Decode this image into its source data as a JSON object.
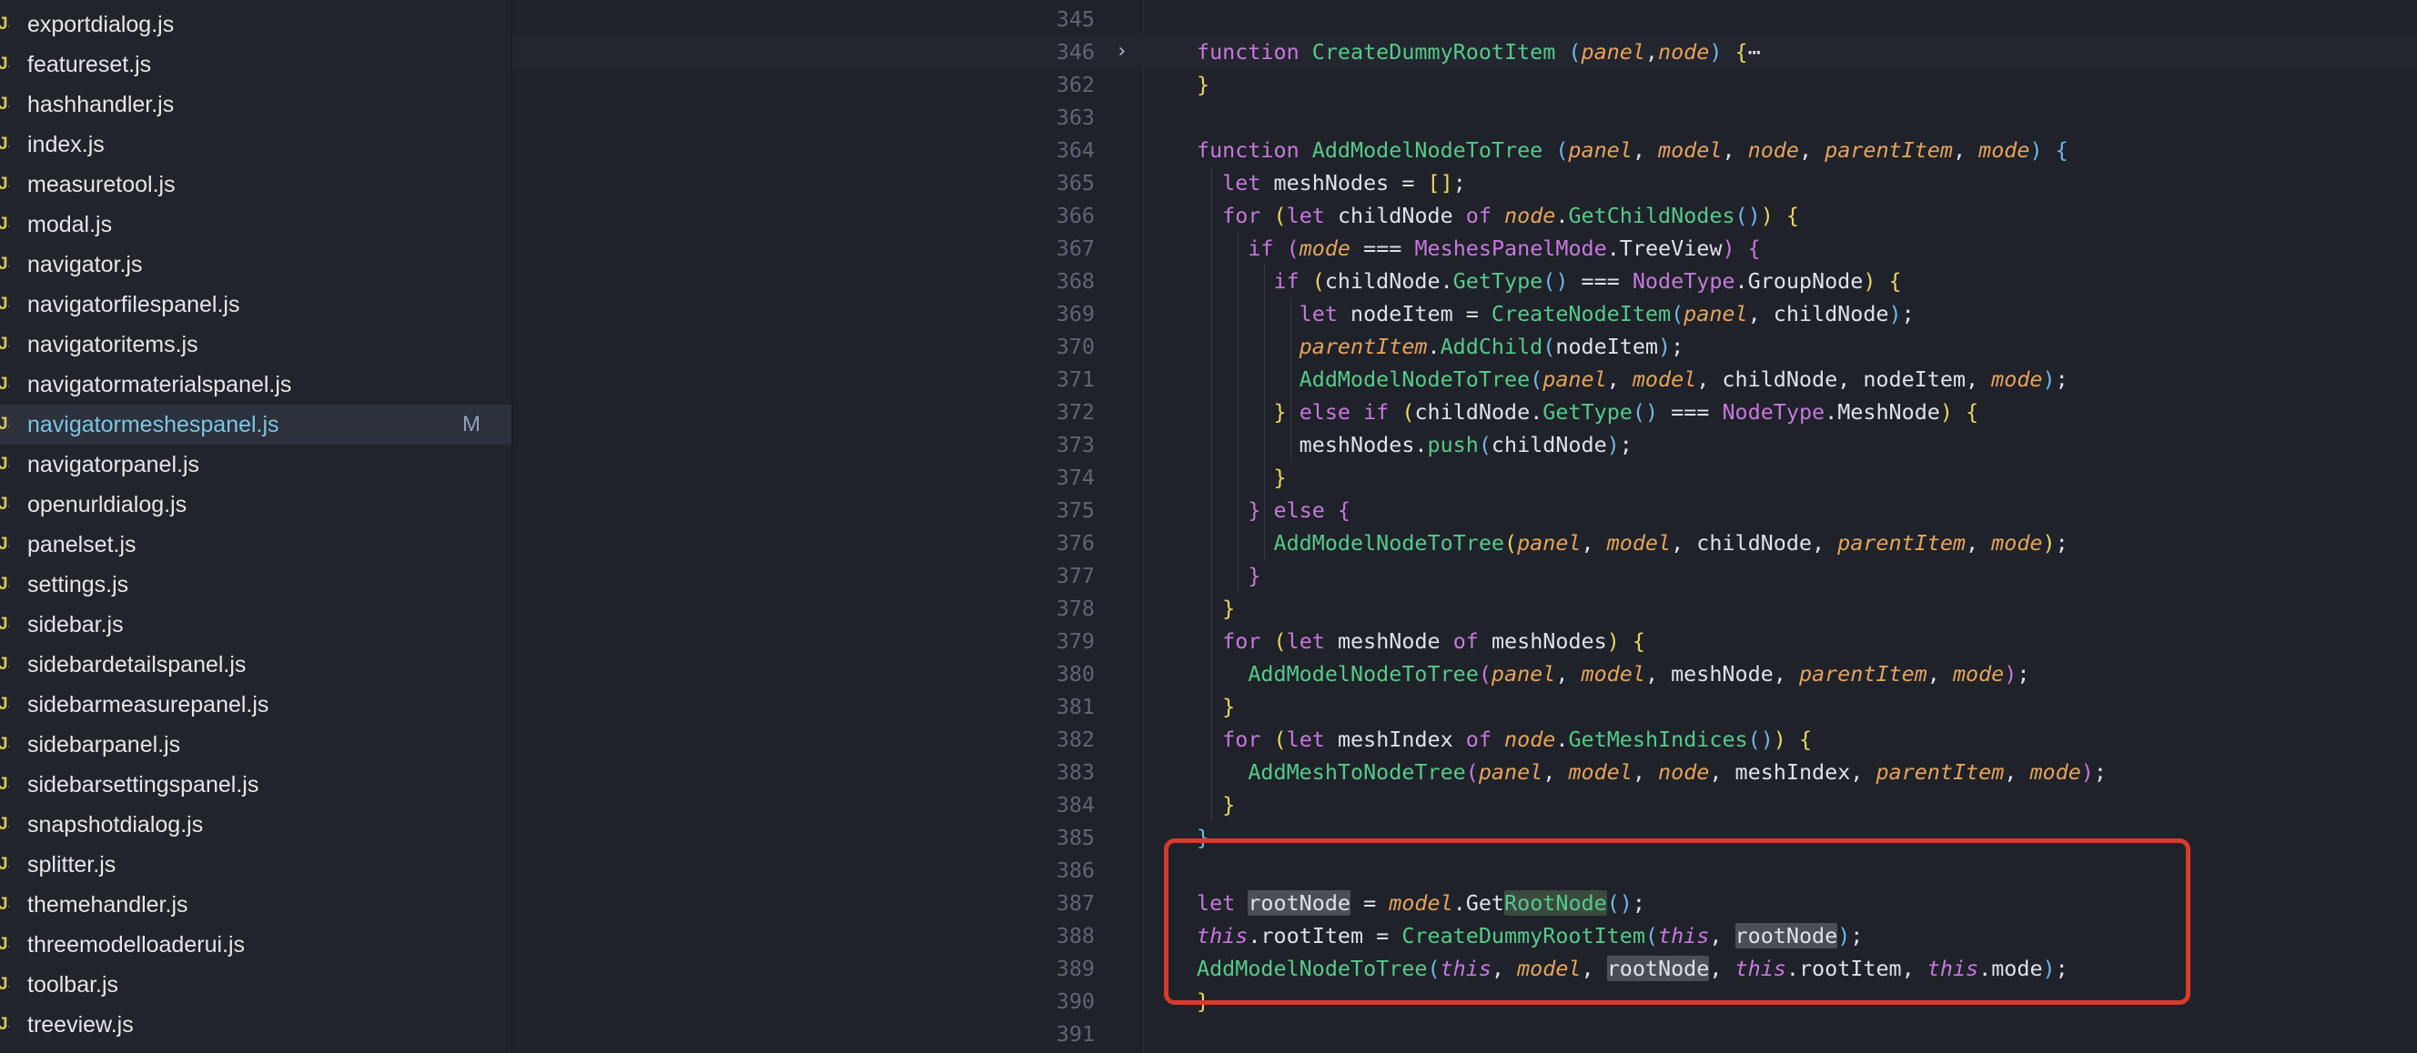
{
  "sidebar": {
    "files": [
      {
        "icon": "JS",
        "name": "exportdialog.js"
      },
      {
        "icon": "JS",
        "name": "featureset.js"
      },
      {
        "icon": "JS",
        "name": "hashhandler.js"
      },
      {
        "icon": "JS",
        "name": "index.js"
      },
      {
        "icon": "JS",
        "name": "measuretool.js"
      },
      {
        "icon": "JS",
        "name": "modal.js"
      },
      {
        "icon": "JS",
        "name": "navigator.js"
      },
      {
        "icon": "JS",
        "name": "navigatorfilespanel.js"
      },
      {
        "icon": "JS",
        "name": "navigatoritems.js"
      },
      {
        "icon": "JS",
        "name": "navigatormaterialspanel.js"
      },
      {
        "icon": "JS",
        "name": "navigatormeshespanel.js",
        "status": "M"
      },
      {
        "icon": "JS",
        "name": "navigatorpanel.js"
      },
      {
        "icon": "JS",
        "name": "openurldialog.js"
      },
      {
        "icon": "JS",
        "name": "panelset.js"
      },
      {
        "icon": "JS",
        "name": "settings.js"
      },
      {
        "icon": "JS",
        "name": "sidebar.js"
      },
      {
        "icon": "JS",
        "name": "sidebardetailspanel.js"
      },
      {
        "icon": "JS",
        "name": "sidebarmeasurepanel.js"
      },
      {
        "icon": "JS",
        "name": "sidebarpanel.js"
      },
      {
        "icon": "JS",
        "name": "sidebarsettingspanel.js"
      },
      {
        "icon": "JS",
        "name": "snapshotdialog.js"
      },
      {
        "icon": "JS",
        "name": "splitter.js"
      },
      {
        "icon": "JS",
        "name": "themehandler.js"
      },
      {
        "icon": "JS",
        "name": "threemodelloaderui.js"
      },
      {
        "icon": "JS",
        "name": "toolbar.js"
      },
      {
        "icon": "JS",
        "name": "treeview.js"
      }
    ]
  },
  "editor": {
    "lines": [
      {
        "n": "345",
        "tokens": []
      },
      {
        "n": "346",
        "fold": "›",
        "tokens": [
          [
            "k",
            "function "
          ],
          [
            "fn",
            "CreateDummyRootItem "
          ],
          [
            "pb",
            "("
          ],
          [
            "p",
            "panel"
          ],
          [
            "",
            ","
          ],
          [
            "p",
            "node"
          ],
          [
            "pb",
            ")"
          ],
          [
            "",
            " "
          ],
          [
            "pl",
            "{"
          ],
          [
            "",
            "⋯"
          ]
        ]
      },
      {
        "n": "362",
        "tokens": [
          [
            "pl",
            "}"
          ]
        ]
      },
      {
        "n": "363",
        "tokens": []
      },
      {
        "n": "364",
        "tokens": [
          [
            "k",
            "function "
          ],
          [
            "fn",
            "AddModelNodeToTree "
          ],
          [
            "pb",
            "("
          ],
          [
            "p",
            "panel"
          ],
          [
            "",
            ", "
          ],
          [
            "p",
            "model"
          ],
          [
            "",
            ", "
          ],
          [
            "p",
            "node"
          ],
          [
            "",
            ", "
          ],
          [
            "p",
            "parentItem"
          ],
          [
            "",
            ", "
          ],
          [
            "p",
            "mode"
          ],
          [
            "pb",
            ")"
          ],
          [
            "",
            " "
          ],
          [
            "pb",
            "{"
          ]
        ]
      },
      {
        "n": "365",
        "tokens": [
          [
            "",
            "  "
          ],
          [
            "k",
            "let "
          ],
          [
            "",
            "meshNodes = "
          ],
          [
            "pl",
            "[]"
          ],
          [
            "",
            ";"
          ]
        ]
      },
      {
        "n": "366",
        "tokens": [
          [
            "",
            "  "
          ],
          [
            "k",
            "for "
          ],
          [
            "pl",
            "("
          ],
          [
            "k",
            "let "
          ],
          [
            "",
            "childNode "
          ],
          [
            "k",
            "of "
          ],
          [
            "p",
            "node"
          ],
          [
            "",
            "."
          ],
          [
            "fn",
            "GetChildNodes"
          ],
          [
            "pb",
            "()"
          ],
          [
            "pl",
            ")"
          ],
          [
            "",
            " "
          ],
          [
            "pl",
            "{"
          ]
        ]
      },
      {
        "n": "367",
        "tokens": [
          [
            "",
            "    "
          ],
          [
            "k",
            "if "
          ],
          [
            "pu",
            "("
          ],
          [
            "p",
            "mode"
          ],
          [
            "",
            " === "
          ],
          [
            "cls",
            "MeshesPanelMode"
          ],
          [
            "",
            ".TreeView"
          ],
          [
            "pu",
            ")"
          ],
          [
            "",
            " "
          ],
          [
            "pu",
            "{"
          ]
        ]
      },
      {
        "n": "368",
        "tokens": [
          [
            "",
            "      "
          ],
          [
            "k",
            "if "
          ],
          [
            "pl",
            "("
          ],
          [
            "",
            "childNode."
          ],
          [
            "fn",
            "GetType"
          ],
          [
            "pb",
            "()"
          ],
          [
            "",
            " === "
          ],
          [
            "cls",
            "NodeType"
          ],
          [
            "",
            ".GroupNode"
          ],
          [
            "pl",
            ")"
          ],
          [
            "",
            " "
          ],
          [
            "pl",
            "{"
          ]
        ]
      },
      {
        "n": "369",
        "tokens": [
          [
            "",
            "        "
          ],
          [
            "k",
            "let "
          ],
          [
            "",
            "nodeItem = "
          ],
          [
            "fn",
            "CreateNodeItem"
          ],
          [
            "pb",
            "("
          ],
          [
            "p",
            "panel"
          ],
          [
            "",
            ", childNode"
          ],
          [
            "pb",
            ")"
          ],
          [
            "",
            ";"
          ]
        ]
      },
      {
        "n": "370",
        "tokens": [
          [
            "",
            "        "
          ],
          [
            "p",
            "parentItem"
          ],
          [
            "",
            "."
          ],
          [
            "fn",
            "AddChild"
          ],
          [
            "pb",
            "("
          ],
          [
            "",
            "nodeItem"
          ],
          [
            "pb",
            ")"
          ],
          [
            "",
            ";"
          ]
        ]
      },
      {
        "n": "371",
        "tokens": [
          [
            "",
            "        "
          ],
          [
            "fn",
            "AddModelNodeToTree"
          ],
          [
            "pb",
            "("
          ],
          [
            "p",
            "panel"
          ],
          [
            "",
            ", "
          ],
          [
            "p",
            "model"
          ],
          [
            "",
            ", childNode, nodeItem, "
          ],
          [
            "p",
            "mode"
          ],
          [
            "pb",
            ")"
          ],
          [
            "",
            ";"
          ]
        ]
      },
      {
        "n": "372",
        "tokens": [
          [
            "",
            "      "
          ],
          [
            "pl",
            "}"
          ],
          [
            "",
            " "
          ],
          [
            "k",
            "else if "
          ],
          [
            "pl",
            "("
          ],
          [
            "",
            "childNode."
          ],
          [
            "fn",
            "GetType"
          ],
          [
            "pb",
            "()"
          ],
          [
            "",
            " === "
          ],
          [
            "cls",
            "NodeType"
          ],
          [
            "",
            ".MeshNode"
          ],
          [
            "pl",
            ")"
          ],
          [
            "",
            " "
          ],
          [
            "pl",
            "{"
          ]
        ]
      },
      {
        "n": "373",
        "tokens": [
          [
            "",
            "        meshNodes."
          ],
          [
            "fn",
            "push"
          ],
          [
            "pb",
            "("
          ],
          [
            "",
            "childNode"
          ],
          [
            "pb",
            ")"
          ],
          [
            "",
            ";"
          ]
        ]
      },
      {
        "n": "374",
        "tokens": [
          [
            "",
            "      "
          ],
          [
            "pl",
            "}"
          ]
        ]
      },
      {
        "n": "375",
        "tokens": [
          [
            "",
            "    "
          ],
          [
            "pu",
            "}"
          ],
          [
            "",
            " "
          ],
          [
            "k",
            "else "
          ],
          [
            "pu",
            "{"
          ]
        ]
      },
      {
        "n": "376",
        "tokens": [
          [
            "",
            "      "
          ],
          [
            "fn",
            "AddModelNodeToTree"
          ],
          [
            "pl",
            "("
          ],
          [
            "p",
            "panel"
          ],
          [
            "",
            ", "
          ],
          [
            "p",
            "model"
          ],
          [
            "",
            ", childNode, "
          ],
          [
            "p",
            "parentItem"
          ],
          [
            "",
            ", "
          ],
          [
            "p",
            "mode"
          ],
          [
            "pl",
            ")"
          ],
          [
            "",
            ";"
          ]
        ]
      },
      {
        "n": "377",
        "tokens": [
          [
            "",
            "    "
          ],
          [
            "pu",
            "}"
          ]
        ]
      },
      {
        "n": "378",
        "tokens": [
          [
            "",
            "  "
          ],
          [
            "pl",
            "}"
          ]
        ]
      },
      {
        "n": "379",
        "tokens": [
          [
            "",
            "  "
          ],
          [
            "k",
            "for "
          ],
          [
            "pl",
            "("
          ],
          [
            "k",
            "let "
          ],
          [
            "",
            "meshNode "
          ],
          [
            "k",
            "of "
          ],
          [
            "",
            "meshNodes"
          ],
          [
            "pl",
            ")"
          ],
          [
            "",
            " "
          ],
          [
            "pl",
            "{"
          ]
        ]
      },
      {
        "n": "380",
        "tokens": [
          [
            "",
            "    "
          ],
          [
            "fn",
            "AddModelNodeToTree"
          ],
          [
            "pu",
            "("
          ],
          [
            "p",
            "panel"
          ],
          [
            "",
            ", "
          ],
          [
            "p",
            "model"
          ],
          [
            "",
            ", meshNode, "
          ],
          [
            "p",
            "parentItem"
          ],
          [
            "",
            ", "
          ],
          [
            "p",
            "mode"
          ],
          [
            "pu",
            ")"
          ],
          [
            "",
            ";"
          ]
        ]
      },
      {
        "n": "381",
        "tokens": [
          [
            "",
            "  "
          ],
          [
            "pl",
            "}"
          ]
        ]
      },
      {
        "n": "382",
        "tokens": [
          [
            "",
            "  "
          ],
          [
            "k",
            "for "
          ],
          [
            "pl",
            "("
          ],
          [
            "k",
            "let "
          ],
          [
            "",
            "meshIndex "
          ],
          [
            "k",
            "of "
          ],
          [
            "p",
            "node"
          ],
          [
            "",
            "."
          ],
          [
            "fn",
            "GetMeshIndices"
          ],
          [
            "pb",
            "()"
          ],
          [
            "pl",
            ")"
          ],
          [
            "",
            " "
          ],
          [
            "pl",
            "{"
          ]
        ]
      },
      {
        "n": "383",
        "tokens": [
          [
            "",
            "    "
          ],
          [
            "fn",
            "AddMeshToNodeTree"
          ],
          [
            "pu",
            "("
          ],
          [
            "p",
            "panel"
          ],
          [
            "",
            ", "
          ],
          [
            "p",
            "model"
          ],
          [
            "",
            ", "
          ],
          [
            "p",
            "node"
          ],
          [
            "",
            ", meshIndex, "
          ],
          [
            "p",
            "parentItem"
          ],
          [
            "",
            ", "
          ],
          [
            "p",
            "mode"
          ],
          [
            "pu",
            ")"
          ],
          [
            "",
            ";"
          ]
        ]
      },
      {
        "n": "384",
        "tokens": [
          [
            "",
            "  "
          ],
          [
            "pl",
            "}"
          ]
        ]
      },
      {
        "n": "385",
        "tokens": [
          [
            "pb",
            "}"
          ]
        ]
      },
      {
        "n": "386",
        "tokens": []
      },
      {
        "n": "387",
        "tokens": [
          [
            "k",
            "let "
          ],
          [
            "hl",
            "rootNode"
          ],
          [
            "",
            " = "
          ],
          [
            "p",
            "model"
          ],
          [
            "",
            ".Get"
          ],
          [
            "hl2fn",
            "RootNode"
          ],
          [
            "pb",
            "()"
          ],
          [
            "",
            ";"
          ]
        ]
      },
      {
        "n": "388",
        "tokens": [
          [
            "t",
            "this"
          ],
          [
            "",
            ".rootItem = "
          ],
          [
            "fn",
            "CreateDummyRootItem"
          ],
          [
            "pb",
            "("
          ],
          [
            "t",
            "this"
          ],
          [
            "",
            ", "
          ],
          [
            "hl",
            "rootNode"
          ],
          [
            "pb",
            ")"
          ],
          [
            "",
            ";"
          ]
        ]
      },
      {
        "n": "389",
        "tokens": [
          [
            "fn",
            "AddModelNodeToTree"
          ],
          [
            "pb",
            "("
          ],
          [
            "t",
            "this"
          ],
          [
            "",
            ", "
          ],
          [
            "p",
            "model"
          ],
          [
            "",
            ", "
          ],
          [
            "hl",
            "rootNode"
          ],
          [
            "",
            ", "
          ],
          [
            "t",
            "this"
          ],
          [
            "",
            ".rootItem, "
          ],
          [
            "t",
            "this"
          ],
          [
            "",
            ".mode"
          ],
          [
            "pb",
            ")"
          ],
          [
            "",
            ";"
          ]
        ]
      },
      {
        "n": "390",
        "tokens": [
          [
            "pl",
            "}"
          ]
        ]
      },
      {
        "n": "391",
        "tokens": []
      }
    ]
  }
}
